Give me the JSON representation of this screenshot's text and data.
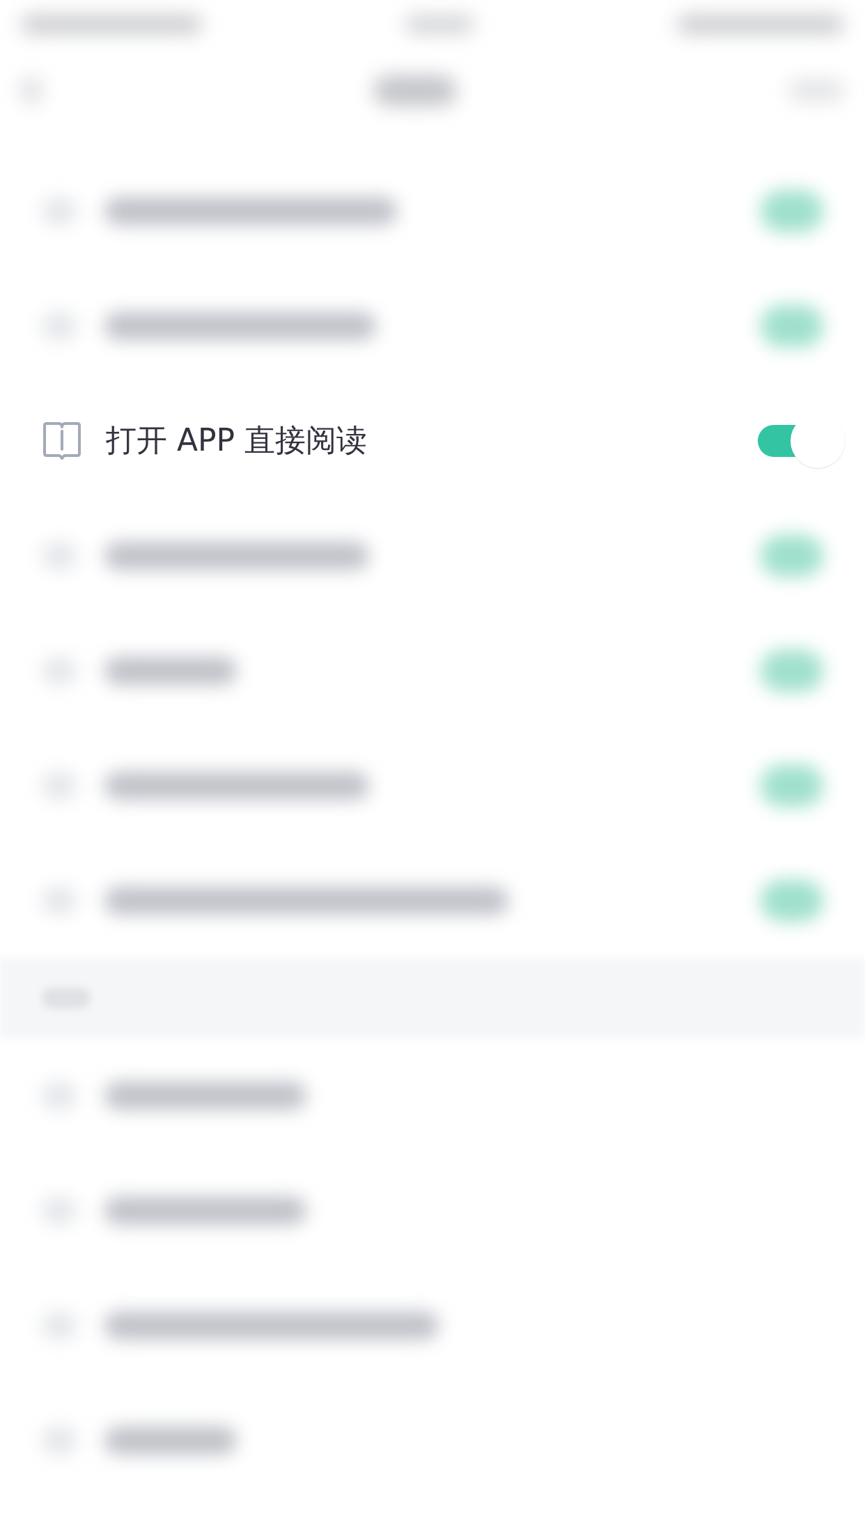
{
  "blurred_toggles_above": [
    {
      "on": true
    },
    {
      "on": true
    }
  ],
  "settings_row": {
    "label": "打开 APP 直接阅读",
    "on": true
  },
  "blurred_toggles_below": [
    {
      "on": true
    },
    {
      "on": true
    },
    {
      "on": true
    },
    {
      "on": true
    }
  ]
}
